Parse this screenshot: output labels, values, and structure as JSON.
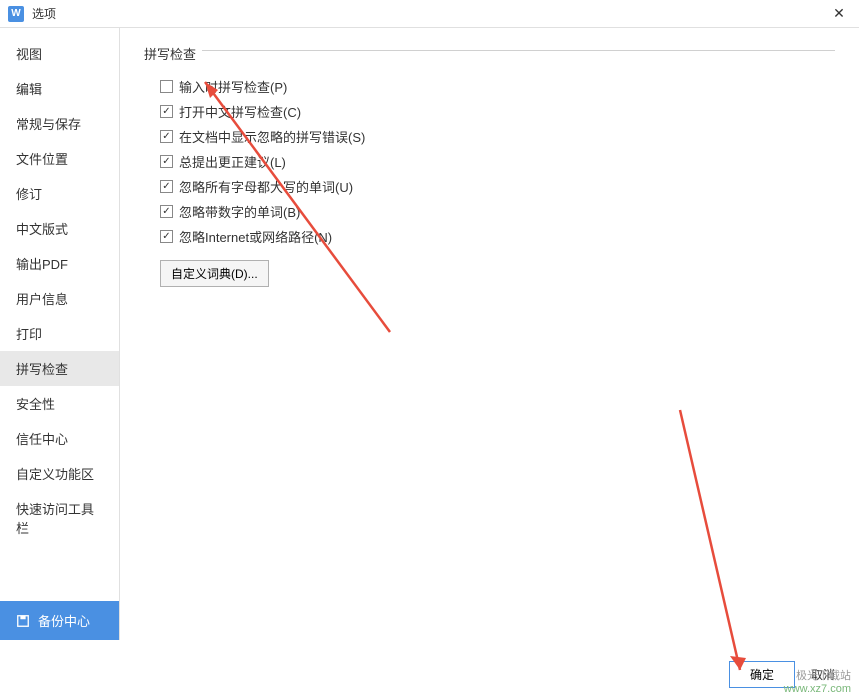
{
  "titlebar": {
    "title": "选项"
  },
  "sidebar": {
    "items": [
      {
        "label": "视图"
      },
      {
        "label": "编辑"
      },
      {
        "label": "常规与保存"
      },
      {
        "label": "文件位置"
      },
      {
        "label": "修订"
      },
      {
        "label": "中文版式"
      },
      {
        "label": "输出PDF"
      },
      {
        "label": "用户信息"
      },
      {
        "label": "打印"
      },
      {
        "label": "拼写检查"
      },
      {
        "label": "安全性"
      },
      {
        "label": "信任中心"
      },
      {
        "label": "自定义功能区"
      },
      {
        "label": "快速访问工具栏"
      }
    ],
    "backup_label": "备份中心"
  },
  "main": {
    "fieldset_label": "拼写检查",
    "options": [
      {
        "label": "输入时拼写检查(P)",
        "checked": false
      },
      {
        "label": "打开中文拼写检查(C)",
        "checked": true
      },
      {
        "label": "在文档中显示忽略的拼写错误(S)",
        "checked": true
      },
      {
        "label": "总提出更正建议(L)",
        "checked": true
      },
      {
        "label": "忽略所有字母都大写的单词(U)",
        "checked": true
      },
      {
        "label": "忽略带数字的单词(B)",
        "checked": true
      },
      {
        "label": "忽略Internet或网络路径(N)",
        "checked": true
      }
    ],
    "custom_dict_btn": "自定义词典(D)..."
  },
  "footer": {
    "ok": "确定",
    "cancel": "取消"
  },
  "watermark": {
    "brand": "极光下载站",
    "url": "www.xz7.com"
  }
}
